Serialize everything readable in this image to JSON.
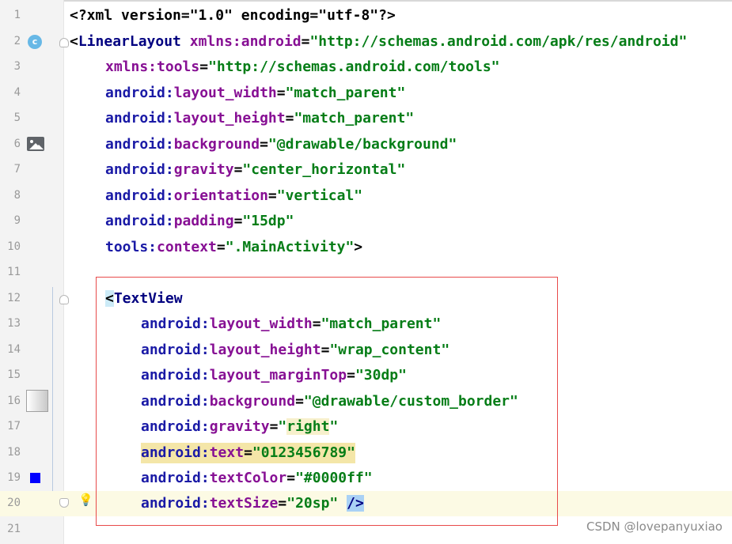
{
  "editor": {
    "lines": [
      {
        "num": "1",
        "tokens": [
          "<?xml version=\"1.0\" encoding=\"utf-8\"?>"
        ]
      },
      {
        "num": "2",
        "tokens": [
          "<",
          "LinearLayout",
          " ",
          "xmlns:android",
          "=",
          "\"http://schemas.android.com/apk/res/android\""
        ]
      },
      {
        "num": "3",
        "tokens": [
          "xmlns:tools",
          "=",
          "\"http://schemas.android.com/tools\""
        ]
      },
      {
        "num": "4",
        "tokens": [
          "android:",
          "layout_width",
          "=",
          "\"match_parent\""
        ]
      },
      {
        "num": "5",
        "tokens": [
          "android:",
          "layout_height",
          "=",
          "\"match_parent\""
        ]
      },
      {
        "num": "6",
        "tokens": [
          "android:",
          "background",
          "=",
          "\"@drawable/background\""
        ]
      },
      {
        "num": "7",
        "tokens": [
          "android:",
          "gravity",
          "=",
          "\"center_horizontal\""
        ]
      },
      {
        "num": "8",
        "tokens": [
          "android:",
          "orientation",
          "=",
          "\"vertical\""
        ]
      },
      {
        "num": "9",
        "tokens": [
          "android:",
          "padding",
          "=",
          "\"15dp\""
        ]
      },
      {
        "num": "10",
        "tokens": [
          "tools:",
          "context",
          "=",
          "\".MainActivity\"",
          ">"
        ]
      },
      {
        "num": "11",
        "tokens": []
      },
      {
        "num": "12",
        "tokens": [
          "<",
          "TextView"
        ]
      },
      {
        "num": "13",
        "tokens": [
          "android:",
          "layout_width",
          "=",
          "\"match_parent\""
        ]
      },
      {
        "num": "14",
        "tokens": [
          "android:",
          "layout_height",
          "=",
          "\"wrap_content\""
        ]
      },
      {
        "num": "15",
        "tokens": [
          "android:",
          "layout_marginTop",
          "=",
          "\"30dp\""
        ]
      },
      {
        "num": "16",
        "tokens": [
          "android:",
          "background",
          "=",
          "\"@drawable/custom_border\""
        ]
      },
      {
        "num": "17",
        "tokens": [
          "android:",
          "gravity",
          "=",
          "\"",
          "right",
          "\""
        ]
      },
      {
        "num": "18",
        "tokens": [
          "android:",
          "text",
          "=",
          "\"0123456789\""
        ]
      },
      {
        "num": "19",
        "tokens": [
          "android:",
          "textColor",
          "=",
          "\"#0000ff\""
        ]
      },
      {
        "num": "20",
        "tokens": [
          "android:",
          "textSize",
          "=",
          "\"20sp\"",
          " ",
          "/>"
        ]
      },
      {
        "num": "21",
        "tokens": []
      }
    ],
    "class_icon_letter": "c",
    "color_swatch": "#0000ff",
    "accent_selection_box": "#e84a4a"
  },
  "watermark": "CSDN @lovepanyuxiao"
}
